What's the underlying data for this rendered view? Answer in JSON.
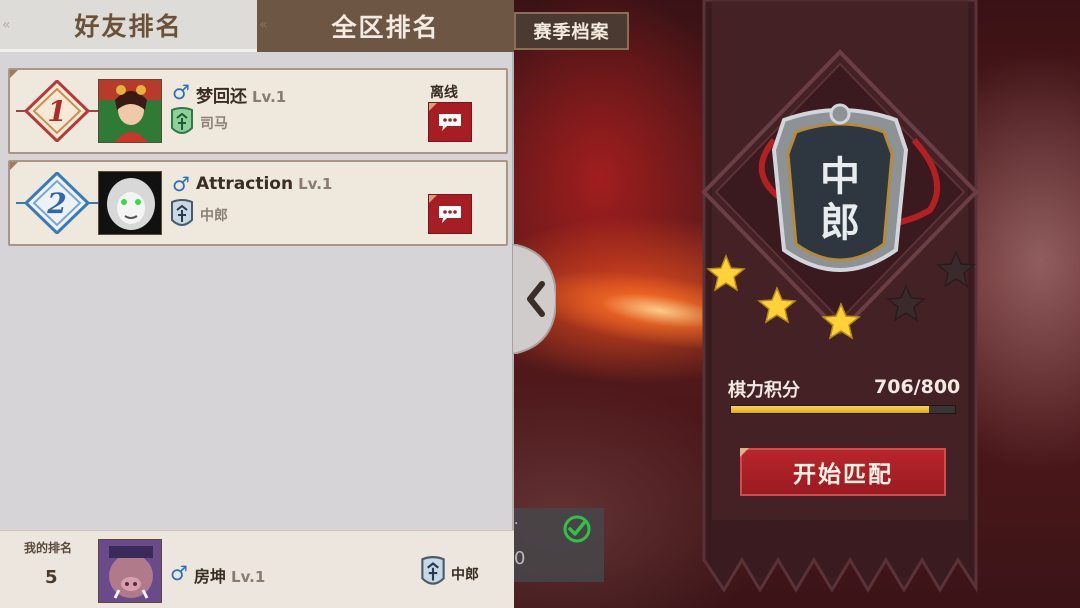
{
  "tabs": {
    "friends": "好友排名",
    "server": "全区排名"
  },
  "season_archive": "赛季档案",
  "ranking": [
    {
      "rank": "1",
      "name": "梦回还",
      "level": "Lv.1",
      "title": "司马",
      "status": "离线"
    },
    {
      "rank": "2",
      "name": "Attraction",
      "level": "Lv.1",
      "title": "中郎",
      "status": ""
    }
  ],
  "my_rank": {
    "label": "我的排名",
    "value": "5",
    "name": "房坤",
    "level": "Lv.1",
    "title": "中郎"
  },
  "tier": {
    "badge_text": "中郎",
    "stars_filled": 3,
    "stars_total": 5
  },
  "points": {
    "label": "棋力积分",
    "value": "706/800",
    "fraction": 0.8825
  },
  "match_button": "开始匹配",
  "task": {
    "partial_text": "0",
    "dot": "."
  },
  "icons": {
    "gender": "male-icon",
    "chat": "chat-bubble-icon",
    "check": "check-circle-icon",
    "collapse": "chevron-left-icon"
  },
  "colors": {
    "accent_red": "#a61e24",
    "gold": "#ffd44a",
    "gender_blue": "#2b6ec4"
  }
}
